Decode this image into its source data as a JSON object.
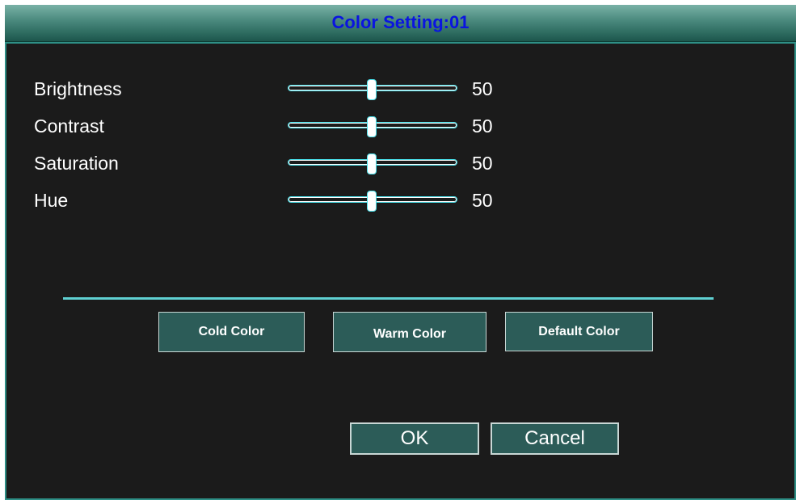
{
  "dialog": {
    "title": "Color Setting:01"
  },
  "settings": [
    {
      "label": "Brightness",
      "value": 50,
      "value_text": "50",
      "min": 0,
      "max": 100
    },
    {
      "label": "Contrast",
      "value": 50,
      "value_text": "50",
      "min": 0,
      "max": 100
    },
    {
      "label": "Saturation",
      "value": 50,
      "value_text": "50",
      "min": 0,
      "max": 100
    },
    {
      "label": "Hue",
      "value": 50,
      "value_text": "50",
      "min": 0,
      "max": 100
    }
  ],
  "presets": {
    "cold_label": "Cold Color",
    "warm_label": "Warm Color",
    "default_label": "Default Color"
  },
  "actions": {
    "ok_label": "OK",
    "cancel_label": "Cancel"
  },
  "colors": {
    "title_text": "#0a14e0",
    "frame": "#2e8f86",
    "slider_accent": "#4ae0ea",
    "button_bg": "#2c5c58",
    "background": "#1b1b1b"
  }
}
